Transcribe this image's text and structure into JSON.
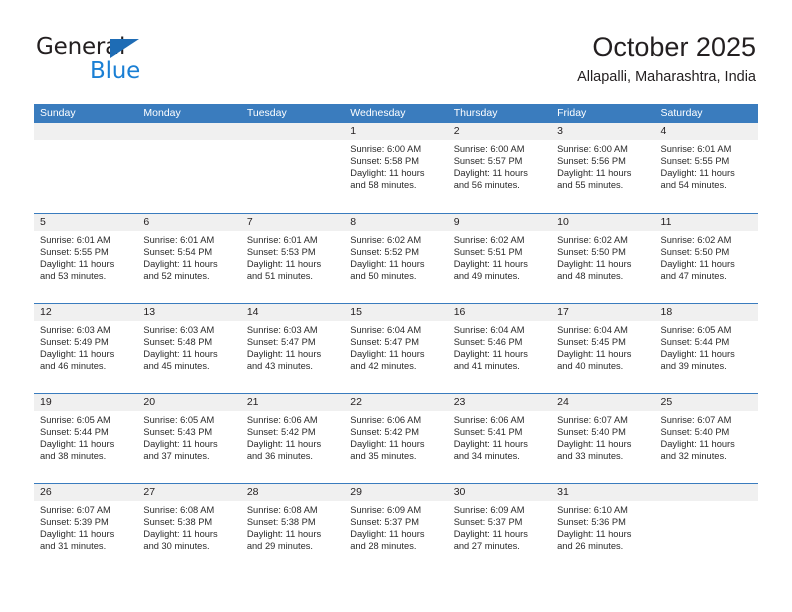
{
  "brand": {
    "name_part1": "General",
    "name_part2": "Blue",
    "accent_color": "#1a7fd4",
    "triangle_color": "#1e6cb5"
  },
  "header": {
    "title": "October 2025",
    "subtitle": "Allapalli, Maharashtra, India"
  },
  "calendar": {
    "header_color": "#3a7cbe",
    "daynumber_band_color": "#f0f0f0",
    "weekdays": [
      "Sunday",
      "Monday",
      "Tuesday",
      "Wednesday",
      "Thursday",
      "Friday",
      "Saturday"
    ],
    "weeks": [
      [
        {
          "day": "",
          "empty": true
        },
        {
          "day": "",
          "empty": true
        },
        {
          "day": "",
          "empty": true
        },
        {
          "day": "1",
          "sunrise": "Sunrise: 6:00 AM",
          "sunset": "Sunset: 5:58 PM",
          "daylight": "Daylight: 11 hours and 58 minutes."
        },
        {
          "day": "2",
          "sunrise": "Sunrise: 6:00 AM",
          "sunset": "Sunset: 5:57 PM",
          "daylight": "Daylight: 11 hours and 56 minutes."
        },
        {
          "day": "3",
          "sunrise": "Sunrise: 6:00 AM",
          "sunset": "Sunset: 5:56 PM",
          "daylight": "Daylight: 11 hours and 55 minutes."
        },
        {
          "day": "4",
          "sunrise": "Sunrise: 6:01 AM",
          "sunset": "Sunset: 5:55 PM",
          "daylight": "Daylight: 11 hours and 54 minutes."
        }
      ],
      [
        {
          "day": "5",
          "sunrise": "Sunrise: 6:01 AM",
          "sunset": "Sunset: 5:55 PM",
          "daylight": "Daylight: 11 hours and 53 minutes."
        },
        {
          "day": "6",
          "sunrise": "Sunrise: 6:01 AM",
          "sunset": "Sunset: 5:54 PM",
          "daylight": "Daylight: 11 hours and 52 minutes."
        },
        {
          "day": "7",
          "sunrise": "Sunrise: 6:01 AM",
          "sunset": "Sunset: 5:53 PM",
          "daylight": "Daylight: 11 hours and 51 minutes."
        },
        {
          "day": "8",
          "sunrise": "Sunrise: 6:02 AM",
          "sunset": "Sunset: 5:52 PM",
          "daylight": "Daylight: 11 hours and 50 minutes."
        },
        {
          "day": "9",
          "sunrise": "Sunrise: 6:02 AM",
          "sunset": "Sunset: 5:51 PM",
          "daylight": "Daylight: 11 hours and 49 minutes."
        },
        {
          "day": "10",
          "sunrise": "Sunrise: 6:02 AM",
          "sunset": "Sunset: 5:50 PM",
          "daylight": "Daylight: 11 hours and 48 minutes."
        },
        {
          "day": "11",
          "sunrise": "Sunrise: 6:02 AM",
          "sunset": "Sunset: 5:50 PM",
          "daylight": "Daylight: 11 hours and 47 minutes."
        }
      ],
      [
        {
          "day": "12",
          "sunrise": "Sunrise: 6:03 AM",
          "sunset": "Sunset: 5:49 PM",
          "daylight": "Daylight: 11 hours and 46 minutes."
        },
        {
          "day": "13",
          "sunrise": "Sunrise: 6:03 AM",
          "sunset": "Sunset: 5:48 PM",
          "daylight": "Daylight: 11 hours and 45 minutes."
        },
        {
          "day": "14",
          "sunrise": "Sunrise: 6:03 AM",
          "sunset": "Sunset: 5:47 PM",
          "daylight": "Daylight: 11 hours and 43 minutes."
        },
        {
          "day": "15",
          "sunrise": "Sunrise: 6:04 AM",
          "sunset": "Sunset: 5:47 PM",
          "daylight": "Daylight: 11 hours and 42 minutes."
        },
        {
          "day": "16",
          "sunrise": "Sunrise: 6:04 AM",
          "sunset": "Sunset: 5:46 PM",
          "daylight": "Daylight: 11 hours and 41 minutes."
        },
        {
          "day": "17",
          "sunrise": "Sunrise: 6:04 AM",
          "sunset": "Sunset: 5:45 PM",
          "daylight": "Daylight: 11 hours and 40 minutes."
        },
        {
          "day": "18",
          "sunrise": "Sunrise: 6:05 AM",
          "sunset": "Sunset: 5:44 PM",
          "daylight": "Daylight: 11 hours and 39 minutes."
        }
      ],
      [
        {
          "day": "19",
          "sunrise": "Sunrise: 6:05 AM",
          "sunset": "Sunset: 5:44 PM",
          "daylight": "Daylight: 11 hours and 38 minutes."
        },
        {
          "day": "20",
          "sunrise": "Sunrise: 6:05 AM",
          "sunset": "Sunset: 5:43 PM",
          "daylight": "Daylight: 11 hours and 37 minutes."
        },
        {
          "day": "21",
          "sunrise": "Sunrise: 6:06 AM",
          "sunset": "Sunset: 5:42 PM",
          "daylight": "Daylight: 11 hours and 36 minutes."
        },
        {
          "day": "22",
          "sunrise": "Sunrise: 6:06 AM",
          "sunset": "Sunset: 5:42 PM",
          "daylight": "Daylight: 11 hours and 35 minutes."
        },
        {
          "day": "23",
          "sunrise": "Sunrise: 6:06 AM",
          "sunset": "Sunset: 5:41 PM",
          "daylight": "Daylight: 11 hours and 34 minutes."
        },
        {
          "day": "24",
          "sunrise": "Sunrise: 6:07 AM",
          "sunset": "Sunset: 5:40 PM",
          "daylight": "Daylight: 11 hours and 33 minutes."
        },
        {
          "day": "25",
          "sunrise": "Sunrise: 6:07 AM",
          "sunset": "Sunset: 5:40 PM",
          "daylight": "Daylight: 11 hours and 32 minutes."
        }
      ],
      [
        {
          "day": "26",
          "sunrise": "Sunrise: 6:07 AM",
          "sunset": "Sunset: 5:39 PM",
          "daylight": "Daylight: 11 hours and 31 minutes."
        },
        {
          "day": "27",
          "sunrise": "Sunrise: 6:08 AM",
          "sunset": "Sunset: 5:38 PM",
          "daylight": "Daylight: 11 hours and 30 minutes."
        },
        {
          "day": "28",
          "sunrise": "Sunrise: 6:08 AM",
          "sunset": "Sunset: 5:38 PM",
          "daylight": "Daylight: 11 hours and 29 minutes."
        },
        {
          "day": "29",
          "sunrise": "Sunrise: 6:09 AM",
          "sunset": "Sunset: 5:37 PM",
          "daylight": "Daylight: 11 hours and 28 minutes."
        },
        {
          "day": "30",
          "sunrise": "Sunrise: 6:09 AM",
          "sunset": "Sunset: 5:37 PM",
          "daylight": "Daylight: 11 hours and 27 minutes."
        },
        {
          "day": "31",
          "sunrise": "Sunrise: 6:10 AM",
          "sunset": "Sunset: 5:36 PM",
          "daylight": "Daylight: 11 hours and 26 minutes."
        },
        {
          "day": "",
          "empty": true
        }
      ]
    ]
  }
}
